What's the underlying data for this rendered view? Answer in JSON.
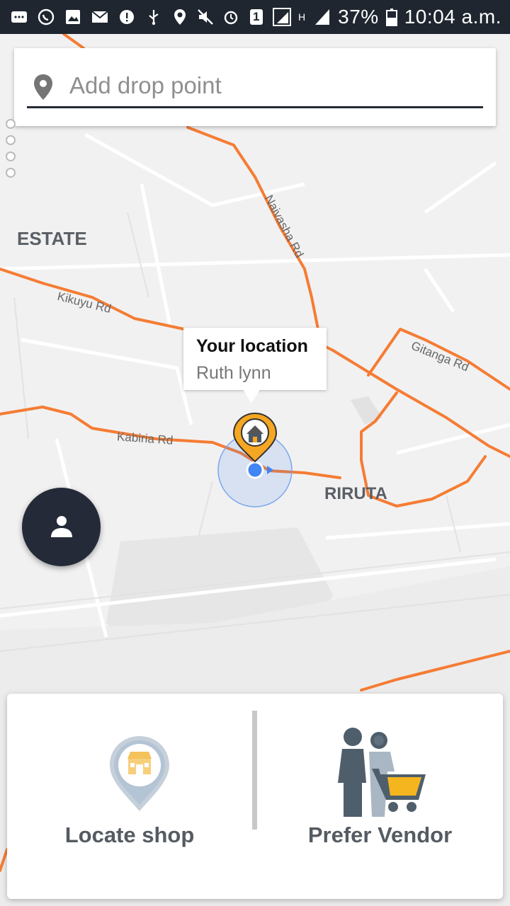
{
  "status_bar": {
    "battery": "37%",
    "time": "10:04 a.m.",
    "sim_slot": "1",
    "network": "H"
  },
  "search": {
    "placeholder": "Add drop point"
  },
  "map": {
    "area_labels": [
      "ESTATE",
      "RIRUTA"
    ],
    "road_labels": [
      "Naivasha Rd",
      "Kikuyu Rd",
      "Gitanga Rd",
      "Kabiria Rd"
    ]
  },
  "info_window": {
    "title": "Your location",
    "subtitle": "Ruth lynn"
  },
  "profile_button": {
    "icon": "person-icon"
  },
  "actions": [
    {
      "label": "Locate shop",
      "icon": "shop-pin-icon"
    },
    {
      "label": "Prefer Vendor",
      "icon": "vendor-cart-icon"
    }
  ],
  "colors": {
    "road": "#f57c34",
    "accent_dark": "#242a38",
    "location_dot": "#4285f4",
    "cart_yellow": "#f5b51f"
  }
}
